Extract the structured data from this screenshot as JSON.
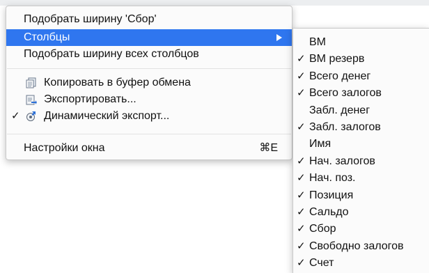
{
  "context_menu": {
    "items": [
      {
        "label": "Подобрать ширину 'Сбор'"
      },
      {
        "label": "Столбцы"
      },
      {
        "label": "Подобрать ширину всех столбцов"
      },
      {
        "label": "Копировать в буфер обмена",
        "icon": "clipboard-copy-icon"
      },
      {
        "label": "Экспортировать...",
        "icon": "export-icon"
      },
      {
        "label": "Динамический экспорт...",
        "icon": "dynamic-export-icon",
        "checked": true
      },
      {
        "label": "Настройки окна",
        "shortcut": "⌘E"
      }
    ],
    "highlight_color": "#2f76ef"
  },
  "columns_submenu": {
    "items": [
      {
        "label": "ВМ",
        "checked": false
      },
      {
        "label": "ВМ резерв",
        "checked": true
      },
      {
        "label": "Всего денег",
        "checked": true
      },
      {
        "label": "Всего залогов",
        "checked": true
      },
      {
        "label": "Забл. денег",
        "checked": false
      },
      {
        "label": "Забл. залогов",
        "checked": true
      },
      {
        "label": "Имя",
        "checked": false
      },
      {
        "label": "Нач. залогов",
        "checked": true
      },
      {
        "label": "Нач. поз.",
        "checked": true
      },
      {
        "label": "Позиция",
        "checked": true
      },
      {
        "label": "Сальдо",
        "checked": true
      },
      {
        "label": "Сбор",
        "checked": true
      },
      {
        "label": "Свободно залогов",
        "checked": true
      },
      {
        "label": "Счет",
        "checked": true
      }
    ],
    "check_glyph": "✓"
  }
}
